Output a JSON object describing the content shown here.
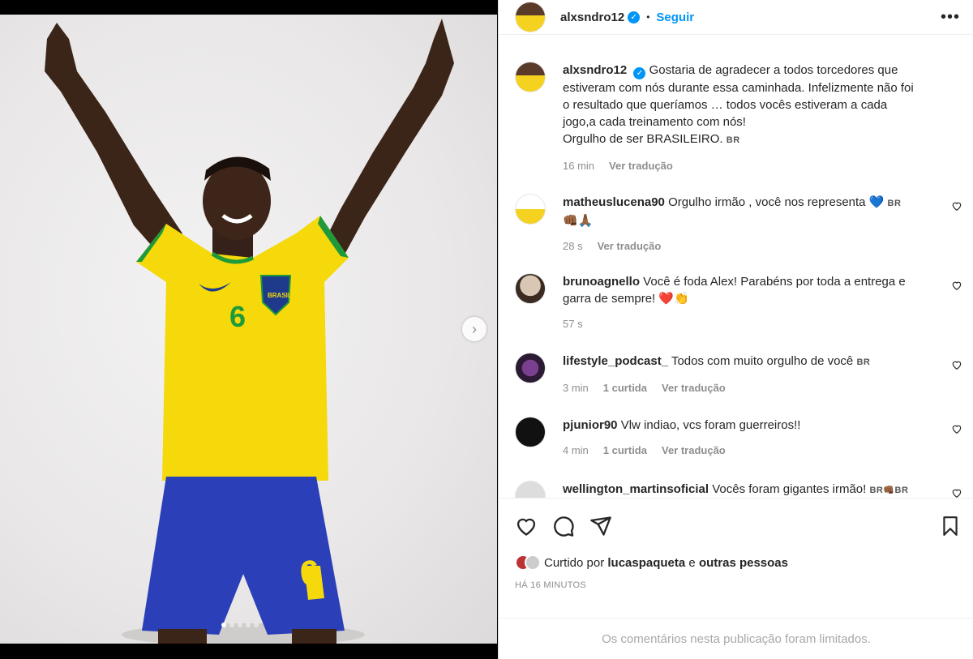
{
  "post": {
    "username": "alxsndro12",
    "follow_label": "Seguir",
    "separator": "•",
    "more_label": "•••",
    "caption_lines": [
      "Gostaria de agradecer a todos torcedores que",
      "estiveram com nós durante essa caminhada. Infelizmente não foi",
      "o resultado que queríamos … todos vocês estiveram a cada",
      "jogo,a cada treinamento com nós!",
      "Orgulho de ser BRASILEIRO."
    ],
    "caption_flag": "BR",
    "caption_time": "16 min",
    "caption_translate": "Ver tradução"
  },
  "media": {
    "jersey_number": "6",
    "jersey_text": "BRASIL",
    "next_label": "›",
    "carousel_total": 5,
    "carousel_active": 1
  },
  "comments": [
    {
      "author": "matheuslucena90",
      "text": "Orgulho irmão , você nos representa 💙",
      "flag": "BR",
      "line2": "👊🏾🙏🏾",
      "time": "28 s",
      "replies": "",
      "translate": "Ver tradução"
    },
    {
      "author": "brunoagnello",
      "text": "Você é foda Alex! Parabéns por toda a entrega e garra de sempre! ❤️👏",
      "flag": "",
      "line2": "",
      "time": "57 s",
      "replies": "",
      "translate": ""
    },
    {
      "author": "lifestyle_podcast_",
      "text": "Todos com muito orgulho de você",
      "flag": "BR",
      "line2": "",
      "time": "3 min",
      "replies": "1 curtida",
      "translate": "Ver tradução"
    },
    {
      "author": "pjunior90",
      "text": "Vlw indiao, vcs foram guerreiros!!",
      "flag": "",
      "line2": "",
      "time": "4 min",
      "replies": "1 curtida",
      "translate": "Ver tradução"
    },
    {
      "author": "wellington_martinsoficial",
      "text": "Vocês foram gigantes irmão!",
      "flag": "BR👊🏾BR",
      "line2": "",
      "time": "",
      "replies": "",
      "translate": ""
    }
  ],
  "likes": {
    "prefix": "Curtido por",
    "user": "lucaspaqueta",
    "joiner": "e",
    "others": "outras pessoas"
  },
  "timestamp": "HÁ 16 MINUTOS",
  "limited_notice": "Os comentários nesta publicação foram limitados.",
  "colors": {
    "accent": "#0095f6",
    "jersey_yellow": "#f5d90a",
    "jersey_green": "#1f9a3a",
    "shorts_blue": "#2a3fb8"
  }
}
